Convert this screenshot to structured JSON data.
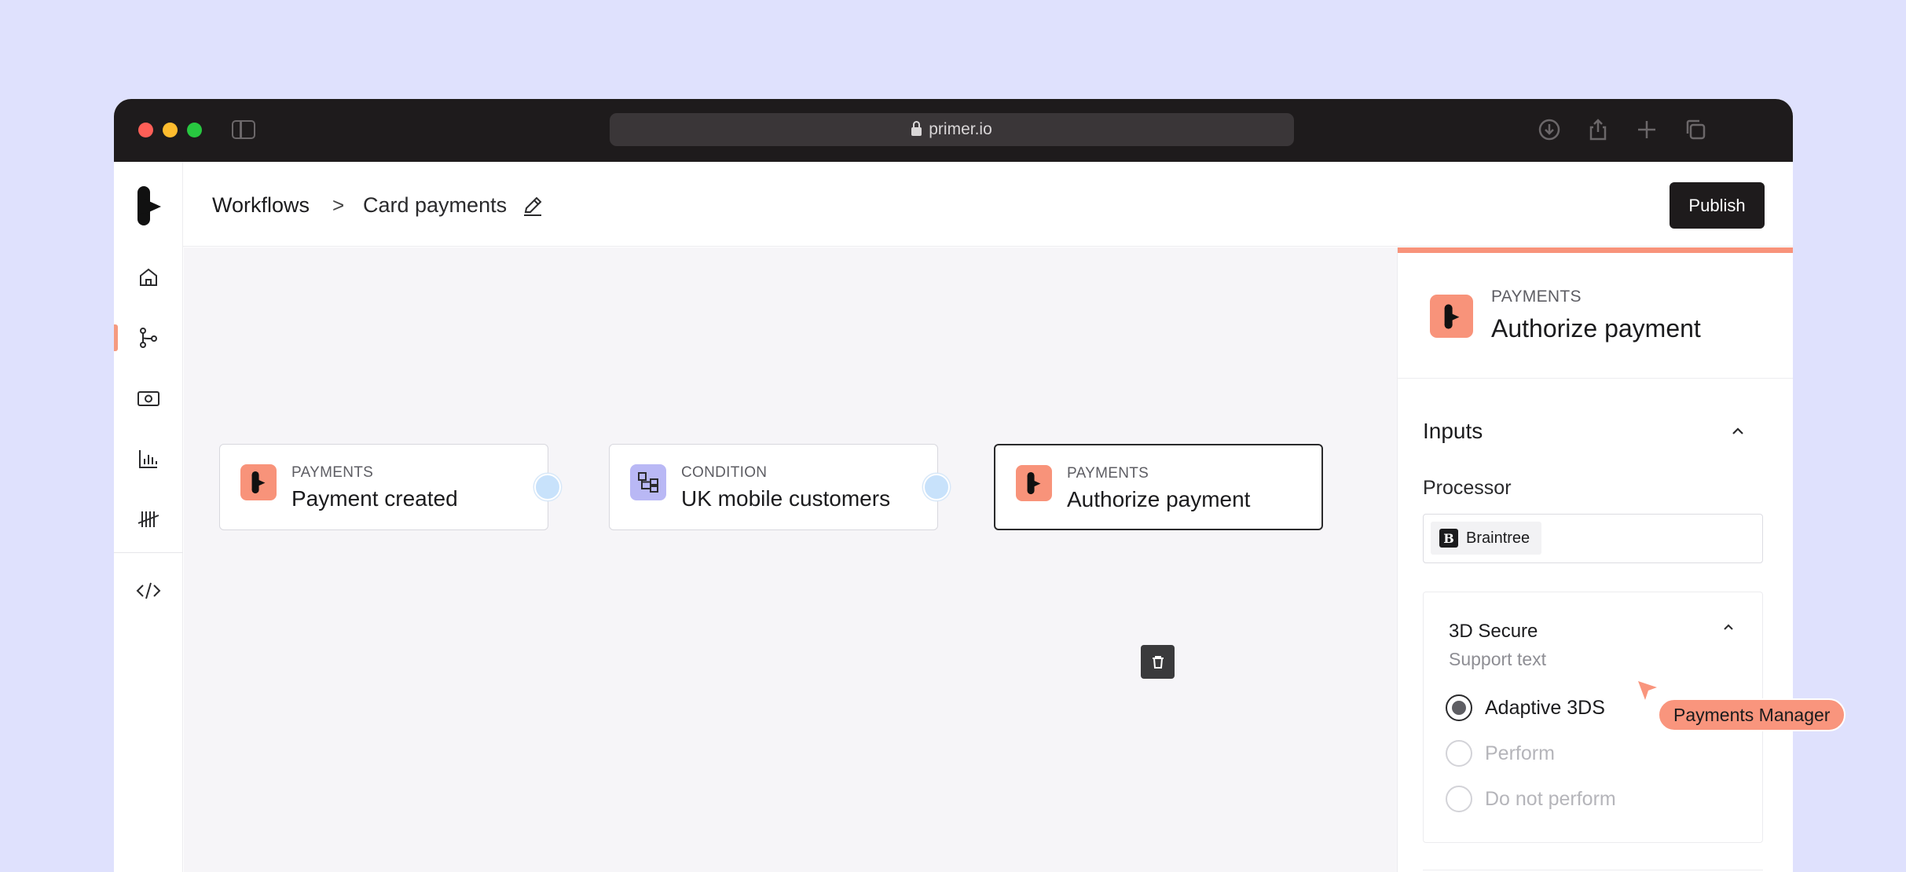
{
  "browser": {
    "url": "primer.io"
  },
  "nav": {
    "items": [
      "home-icon",
      "workflows-icon",
      "cash-icon",
      "chart-icon",
      "tally-icon",
      "code-icon"
    ],
    "active": "workflows-icon"
  },
  "header": {
    "breadcrumb_root": "Workflows",
    "breadcrumb_separator": ">",
    "breadcrumb_current": "Card payments",
    "publish_label": "Publish"
  },
  "canvas": {
    "nodes": [
      {
        "category": "PAYMENTS",
        "title": "Payment created",
        "icon": "primer-logo-icon"
      },
      {
        "category": "CONDITION",
        "title": "UK mobile customers",
        "icon": "condition-icon"
      },
      {
        "category": "PAYMENTS",
        "title": "Authorize payment",
        "icon": "primer-logo-icon"
      }
    ]
  },
  "panel": {
    "category": "PAYMENTS",
    "title": "Authorize payment",
    "inputs_label": "Inputs",
    "processor_label": "Processor",
    "processor_value": "Braintree",
    "processor_logo_letter": "B",
    "three_ds": {
      "title": "3D Secure",
      "support_text": "Support text",
      "options": [
        "Adaptive 3DS",
        "Perform",
        "Do not perform"
      ],
      "selected": "Adaptive 3DS"
    }
  },
  "cursor_tag": "Payments Manager",
  "colors": {
    "accent": "#f8937a",
    "condition": "#b9b8f5",
    "dark": "#1e1b1c",
    "background": "#dfe1fd"
  }
}
